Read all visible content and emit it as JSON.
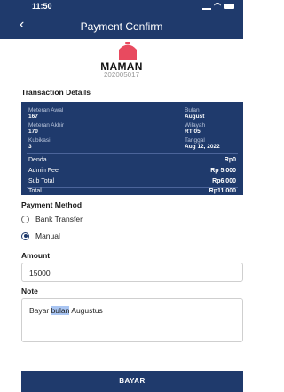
{
  "status_bar": {
    "time": "11:50"
  },
  "nav": {
    "title": "Payment Confirm"
  },
  "merchant": {
    "name": "MAMAN",
    "id": "202005017"
  },
  "transaction": {
    "section_title": "Transaction Details",
    "left": [
      {
        "label": "Meteran Awal",
        "value": "167"
      },
      {
        "label": "Meteran Akhir",
        "value": "170"
      },
      {
        "label": "Kubikasi",
        "value": "3"
      }
    ],
    "right": [
      {
        "label": "Bulan",
        "value": "August"
      },
      {
        "label": "Wilayah",
        "value": "RT 05"
      },
      {
        "label": "Tanggal",
        "value": "Aug 12, 2022"
      }
    ],
    "rows": [
      {
        "label": "Denda",
        "value": "Rp0"
      },
      {
        "label": "Admin Fee",
        "value": "Rp 5.000"
      },
      {
        "label": "Sub Total",
        "value": "Rp6.000"
      }
    ],
    "total": {
      "label": "Total",
      "value": "Rp11.000"
    }
  },
  "payment_method": {
    "title": "Payment Method",
    "options": [
      {
        "label": "Bank Transfer",
        "selected": false
      },
      {
        "label": "Manual",
        "selected": true
      }
    ]
  },
  "amount": {
    "label": "Amount",
    "value": "15000"
  },
  "note": {
    "label": "Note",
    "before": "Bayar ",
    "highlight": "bulan",
    "after": " Augustus"
  },
  "button": {
    "label": "BAYAR"
  },
  "colors": {
    "primary": "#1f3a6c",
    "accent_highlight": "#a9c5f2",
    "merchant_icon": "#e84a5f"
  }
}
